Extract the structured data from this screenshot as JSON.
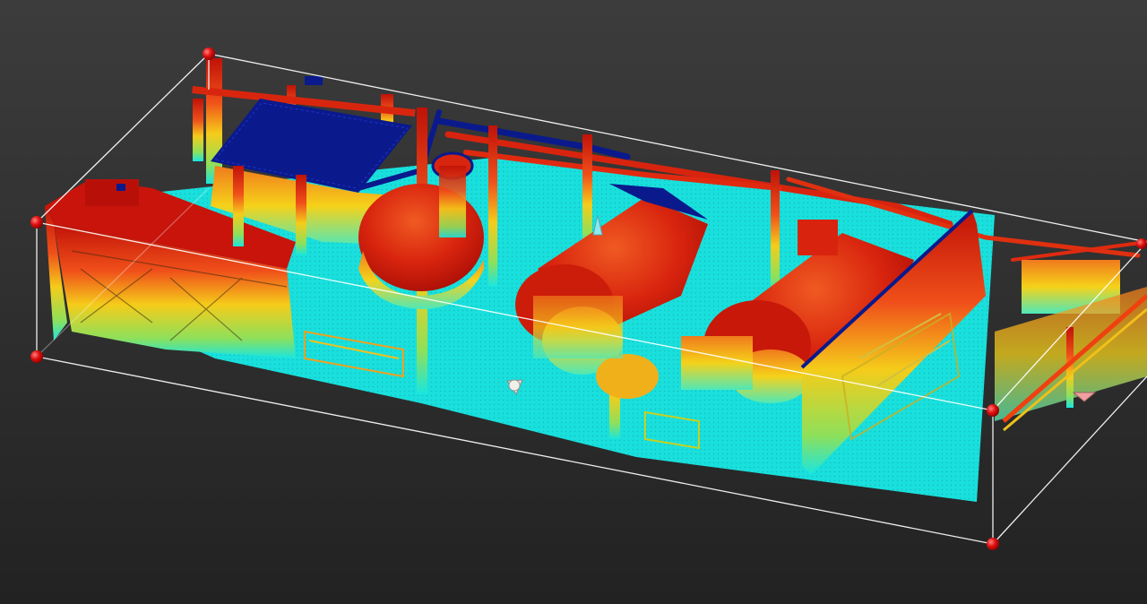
{
  "viewport": {
    "background_top": "#3c3c3c",
    "background_bottom": "#222222"
  },
  "point_cloud": {
    "colormap": "height",
    "color_low": "#19e6e0",
    "color_mid": "#f2e21a",
    "color_high": "#e01a0e",
    "color_top": "#0a1a8c"
  },
  "bounding_box": {
    "edge_color": "#ffffff",
    "handle_color": "#e01010",
    "handle_count": 6
  },
  "scanner_positions": 2
}
